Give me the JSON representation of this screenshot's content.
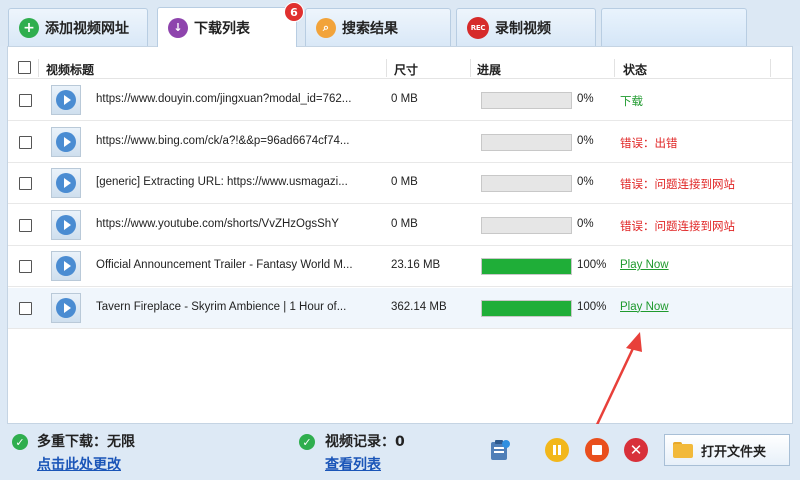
{
  "tabs": [
    {
      "label": "添加视频网址",
      "icon": "add-icon"
    },
    {
      "label": "下载列表",
      "icon": "download-icon",
      "badge": "6"
    },
    {
      "label": "搜索结果",
      "icon": "search-icon"
    },
    {
      "label": "录制视频",
      "icon": "rec-icon",
      "icon_text": "REC"
    }
  ],
  "table": {
    "columns": {
      "title": "视频标题",
      "size": "尺寸",
      "progress": "进展",
      "status": "状态"
    },
    "rows": [
      {
        "title": "https://www.douyin.com/jingxuan?modal_id=762...",
        "size": "0 MB",
        "progress": 0,
        "pct": "0%",
        "status": "下载",
        "status_kind": "green"
      },
      {
        "title": "https://www.bing.com/ck/a?!&&p=96ad6674cf74...",
        "size": "",
        "progress": 0,
        "pct": "0%",
        "status": "错误：出错",
        "status_kind": "red"
      },
      {
        "title": "[generic] Extracting URL: https://www.usmagazi...",
        "size": "0 MB",
        "progress": 0,
        "pct": "0%",
        "status": "错误：问题连接到网站",
        "status_kind": "red"
      },
      {
        "title": "https://www.youtube.com/shorts/VvZHzOgsShY",
        "size": "0 MB",
        "progress": 0,
        "pct": "0%",
        "status": "错误：问题连接到网站",
        "status_kind": "red"
      },
      {
        "title": "Official Announcement Trailer - Fantasy World M...",
        "size": "23.16 MB",
        "progress": 1,
        "pct": "100%",
        "status": "Play Now",
        "status_kind": "link"
      },
      {
        "title": "Tavern Fireplace - Skyrim Ambience | 1 Hour of...",
        "size": "362.14 MB",
        "progress": 1,
        "pct": "100%",
        "status": "Play Now",
        "status_kind": "link"
      }
    ]
  },
  "footer": {
    "multi_label": "多重下载：无限",
    "multi_link": "点击此处更改",
    "record_label": "视频记录：0",
    "record_link": "查看列表",
    "open_folder": "打开文件夹"
  },
  "colors": {
    "progress_fill": "#1fae38",
    "status_green": "#1f9a2e",
    "status_red": "#e02525",
    "link_blue": "#1a55b8"
  }
}
